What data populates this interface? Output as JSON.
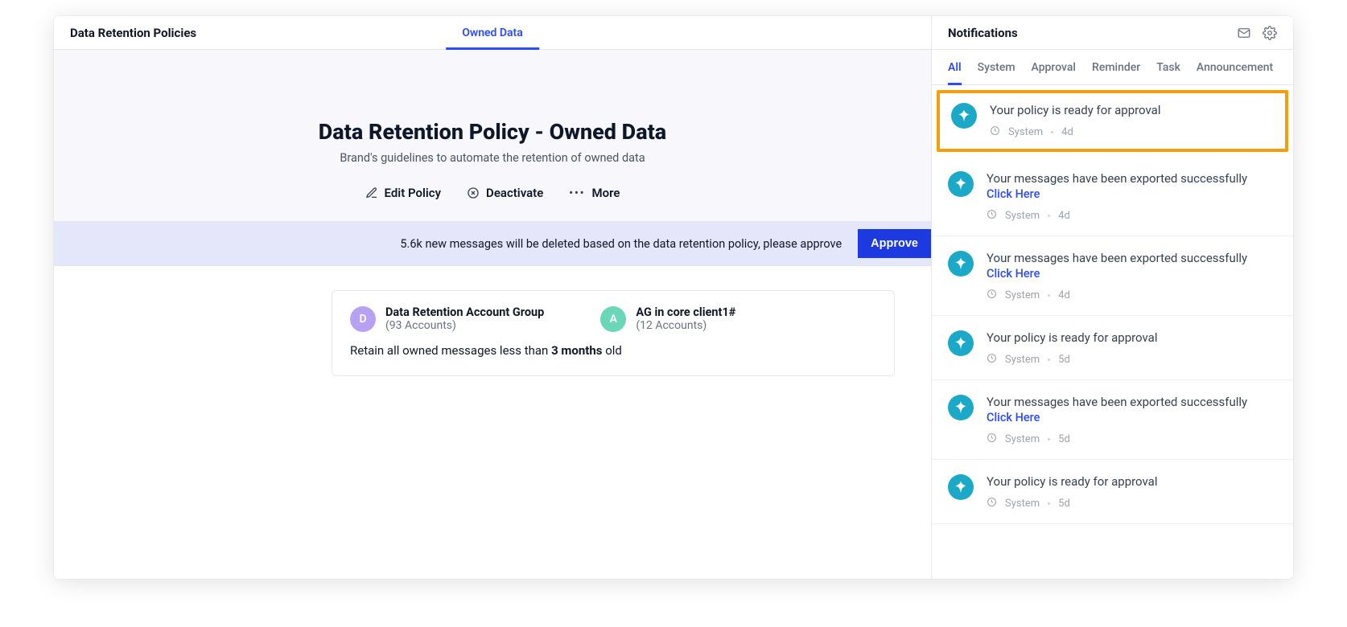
{
  "header": {
    "title": "Data Retention Policies",
    "tabs": [
      {
        "label": "Owned Data",
        "active": true
      }
    ]
  },
  "hero": {
    "heading": "Data Retention Policy - Owned Data",
    "subheading": "Brand's guidelines to automate the retention of owned data",
    "actions": {
      "edit": "Edit Policy",
      "deactivate": "Deactivate",
      "more": "More"
    }
  },
  "banner": {
    "text": "5.6k new messages will be deleted based on the data retention policy, please approve",
    "button": "Approve"
  },
  "card": {
    "groups": [
      {
        "letter": "D",
        "color": "purple",
        "title": "Data Retention Account Group",
        "sub": "(93 Accounts)"
      },
      {
        "letter": "A",
        "color": "green",
        "title": "AG in core client1#",
        "sub": "(12 Accounts)"
      }
    ],
    "retain_pre": "Retain all owned messages less than ",
    "retain_bold": "3 months",
    "retain_post": " old"
  },
  "notifications": {
    "title": "Notifications",
    "tabs": [
      "All",
      "System",
      "Approval",
      "Reminder",
      "Task",
      "Announcement"
    ],
    "active_tab": "All",
    "items": [
      {
        "title": "Your policy is ready for approval",
        "link": "",
        "source": "System",
        "age": "4d",
        "highlight": true
      },
      {
        "title": "Your messages have been exported successfully",
        "link": "Click Here",
        "source": "System",
        "age": "4d",
        "highlight": false
      },
      {
        "title": "Your messages have been exported successfully",
        "link": "Click Here",
        "source": "System",
        "age": "4d",
        "highlight": false
      },
      {
        "title": "Your policy is ready for approval",
        "link": "",
        "source": "System",
        "age": "5d",
        "highlight": false
      },
      {
        "title": "Your messages have been exported successfully",
        "link": "Click Here",
        "source": "System",
        "age": "5d",
        "highlight": false
      },
      {
        "title": "Your policy is ready for approval",
        "link": "",
        "source": "System",
        "age": "5d",
        "highlight": false
      }
    ]
  }
}
